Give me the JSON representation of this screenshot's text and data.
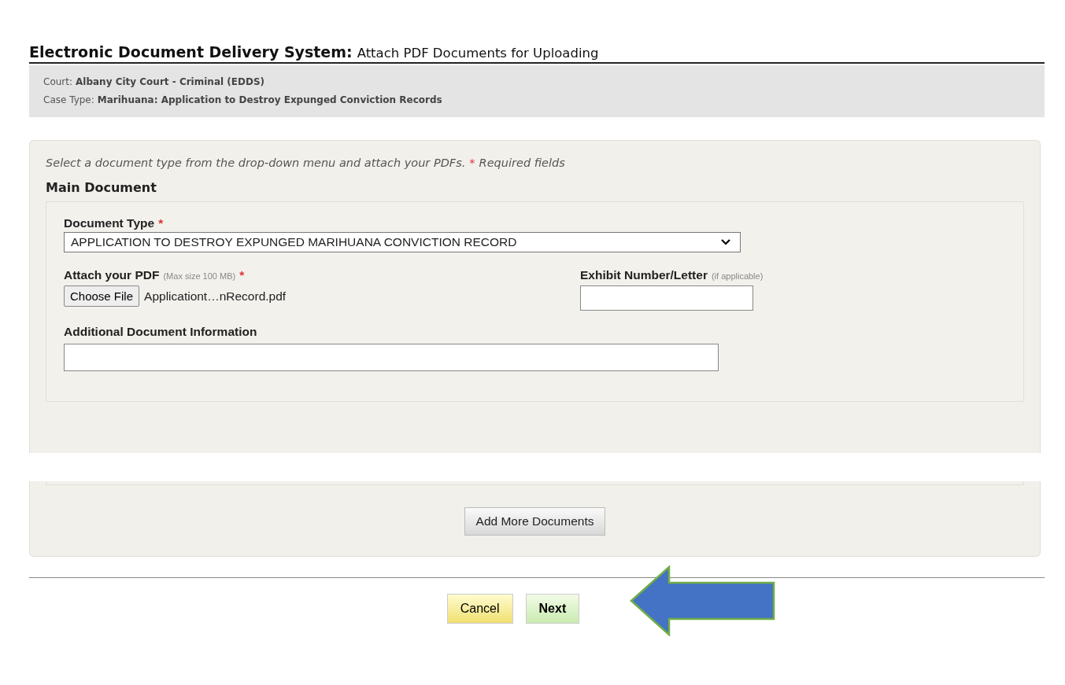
{
  "header": {
    "title": "Electronic Document Delivery System:",
    "subtitle": "Attach PDF Documents for Uploading"
  },
  "case_info": [
    {
      "label": "Court:",
      "value": "Albany City Court - Criminal (EDDS)"
    },
    {
      "label": "Case Type:",
      "value": "Marihuana: Application to Destroy Expunged Conviction Records"
    }
  ],
  "instructions": {
    "text": "Select a document type from the drop-down menu and attach your PDFs.",
    "required_mark": "*",
    "required_note": "Required fields"
  },
  "main_document": {
    "heading": "Main Document",
    "document_type": {
      "label": "Document Type",
      "required_mark": "*",
      "value": "APPLICATION TO DESTROY EXPUNGED MARIHUANA CONVICTION RECORD"
    },
    "attach_pdf": {
      "label": "Attach your PDF",
      "hint": "(Max size 100 MB)",
      "required_mark": "*",
      "button": "Choose File",
      "file_name": "Applicationt…nRecord.pdf"
    },
    "exhibit": {
      "label": "Exhibit Number/Letter",
      "hint": "(if applicable)"
    },
    "additional_info": {
      "label": "Additional Document Information"
    }
  },
  "add_more_button": "Add More Documents",
  "buttons": [
    {
      "label": "Cancel",
      "kind": "cancel"
    },
    {
      "label": "Next",
      "kind": "next"
    }
  ]
}
